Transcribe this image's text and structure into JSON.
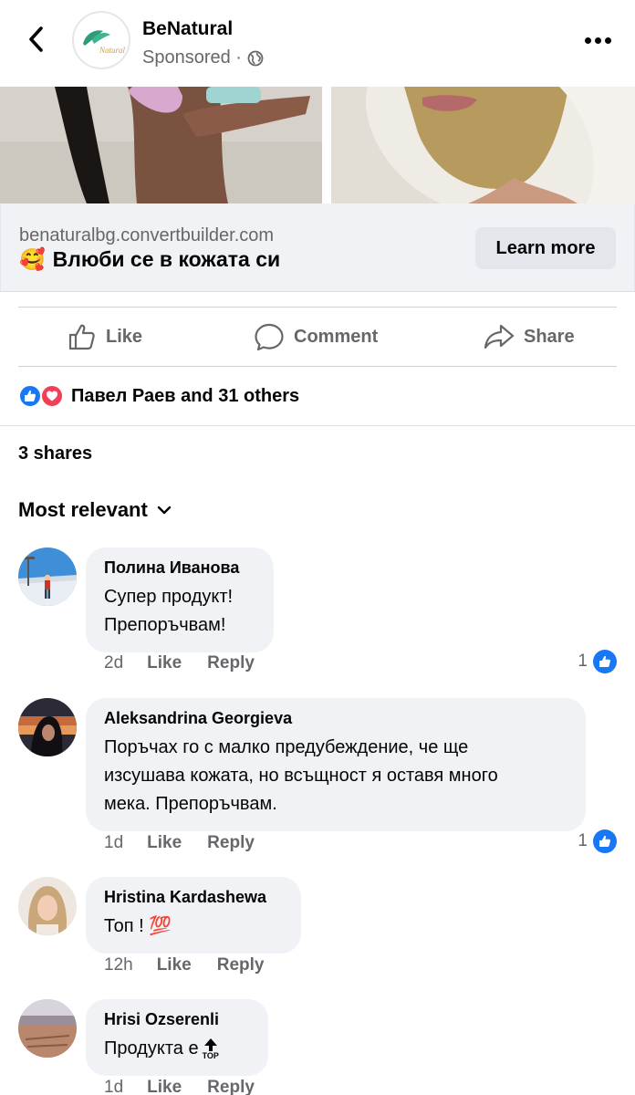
{
  "header": {
    "page_name": "BeNatural",
    "sponsored": "Sponsored ·",
    "logo_text": "Natural"
  },
  "link_preview": {
    "domain": "benaturalbg.convertbuilder.com",
    "emoji": "🥰",
    "headline": "Влюби се в кожата си",
    "cta": "Learn more"
  },
  "actions": {
    "like": "Like",
    "comment": "Comment",
    "share": "Share"
  },
  "reactions": {
    "summary": "Павел Раев and 31 others"
  },
  "shares": "3 shares",
  "sort_label": "Most relevant",
  "comments": [
    {
      "name": "Полина Иванова",
      "text_lines": [
        "Супер продукт!",
        "Препоръчвам!"
      ],
      "time": "2d",
      "like": "Like",
      "reply": "Reply",
      "likes": "1"
    },
    {
      "name": "Aleksandrina Georgieva",
      "text_lines": [
        "Поръчах го с малко предубеждение, че ще",
        "изсушава кожата, но всъщност я оставя много",
        "мека. Препоръчвам."
      ],
      "time": "1d",
      "like": "Like",
      "reply": "Reply",
      "likes": "1"
    },
    {
      "name": "Hristina Kardashewa",
      "text": "Топ ! ",
      "emoji": "💯",
      "time": "12h",
      "like": "Like",
      "reply": "Reply"
    },
    {
      "name": "Hrisi Ozserenli",
      "text": "Продукта е ",
      "emoji_label": "TOP",
      "time": "1d",
      "like": "Like",
      "reply": "Reply"
    }
  ],
  "colors": {
    "primary_text": "#050505",
    "secondary_text": "#65676b",
    "facebook_blue": "#1877f2",
    "love_red": "#f33e58",
    "bubble_bg": "#f0f2f5",
    "brand_green": "#2e9b7a"
  }
}
